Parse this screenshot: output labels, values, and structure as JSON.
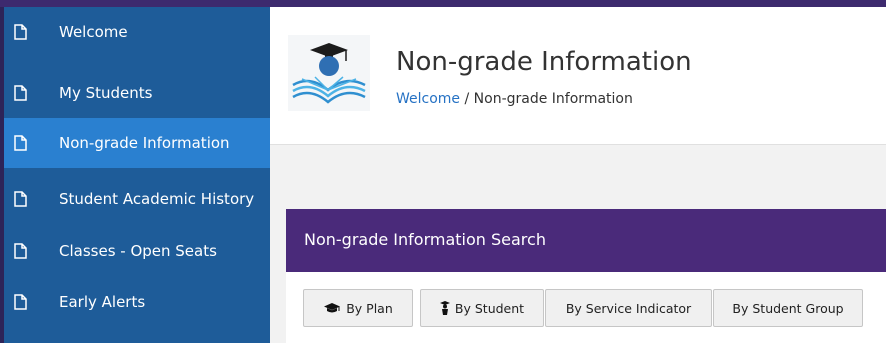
{
  "sidebar": {
    "items": [
      {
        "label": "Welcome",
        "icon": "document-icon"
      },
      {
        "label": "My Students",
        "icon": "document-icon"
      },
      {
        "label": "Non-grade Information",
        "icon": "document-icon",
        "active": true
      },
      {
        "label": "Student Academic History",
        "icon": "document-icon"
      },
      {
        "label": "Classes - Open Seats",
        "icon": "document-icon"
      },
      {
        "label": "Early Alerts",
        "icon": "document-icon"
      }
    ]
  },
  "header": {
    "title": "Non-grade Information",
    "breadcrumb": {
      "home": "Welcome",
      "separator": "/",
      "current": "Non-grade Information"
    }
  },
  "panel": {
    "title": "Non-grade Information Search",
    "buttons": {
      "by_plan": "By Plan",
      "by_student": "By Student",
      "by_service_indicator": "By Service Indicator",
      "by_student_group": "By Student Group"
    }
  },
  "colors": {
    "sidebar_bg": "#1e5c99",
    "sidebar_active": "#2a80d0",
    "panel_header": "#4a2a7a",
    "link": "#2672c4"
  }
}
